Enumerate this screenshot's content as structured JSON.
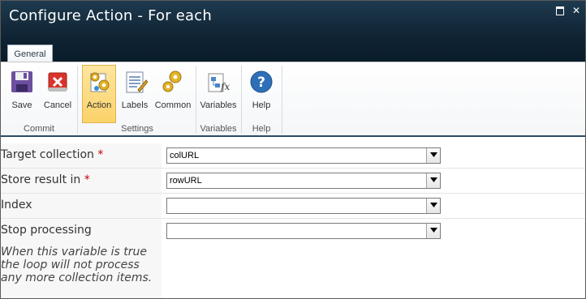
{
  "window": {
    "title": "Configure Action - For each",
    "controls": {
      "maximize": "maximize",
      "close": "close"
    }
  },
  "ribbon": {
    "tab": "General",
    "groups": {
      "commit": "Commit",
      "settings": "Settings",
      "variables": "Variables",
      "help": "Help"
    },
    "buttons": {
      "save": "Save",
      "cancel": "Cancel",
      "action": "Action",
      "labels": "Labels",
      "common": "Common",
      "variables": "Variables",
      "help": "Help"
    },
    "active_button": "Action"
  },
  "form": {
    "target_collection": {
      "label": "Target collection",
      "required": "*",
      "value": "colURL"
    },
    "store_result_in": {
      "label": "Store result in",
      "required": "*",
      "value": "rowURL"
    },
    "index": {
      "label": "Index",
      "value": ""
    },
    "stop_processing": {
      "label": "Stop processing",
      "value": "",
      "help_lines": [
        "When this variable is true",
        "the loop will not process",
        "any more collection items."
      ]
    }
  },
  "colors": {
    "title_bar": "#0f2333",
    "active_button": "#fbd26a",
    "required": "#c00000"
  }
}
